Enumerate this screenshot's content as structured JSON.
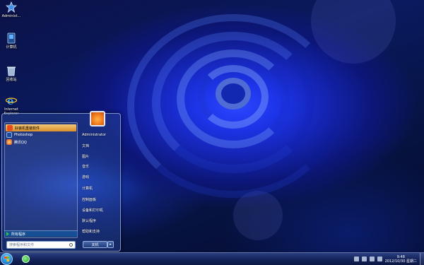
{
  "desktop": {
    "icons": [
      {
        "label": "Administ..."
      },
      {
        "label": "计算机"
      },
      {
        "label": "回收站"
      },
      {
        "label": "Internet Explorer"
      }
    ]
  },
  "start_menu": {
    "pinned": [
      {
        "label": "好装机重装软件"
      },
      {
        "label": "Photoshop"
      },
      {
        "label": "腾讯QQ"
      }
    ],
    "all_programs": "所有程序",
    "search_placeholder": "搜索程序和文件",
    "user_name": "Administrator",
    "right_items": [
      "文档",
      "图片",
      "音乐",
      "游戏",
      "计算机",
      "控制面板",
      "设备和打印机",
      "默认程序",
      "帮助和支持"
    ],
    "shutdown_label": "关机",
    "shutdown_arrow": "▸"
  },
  "taskbar": {
    "time": "9:48",
    "date": "2012/10/30 星期二"
  }
}
